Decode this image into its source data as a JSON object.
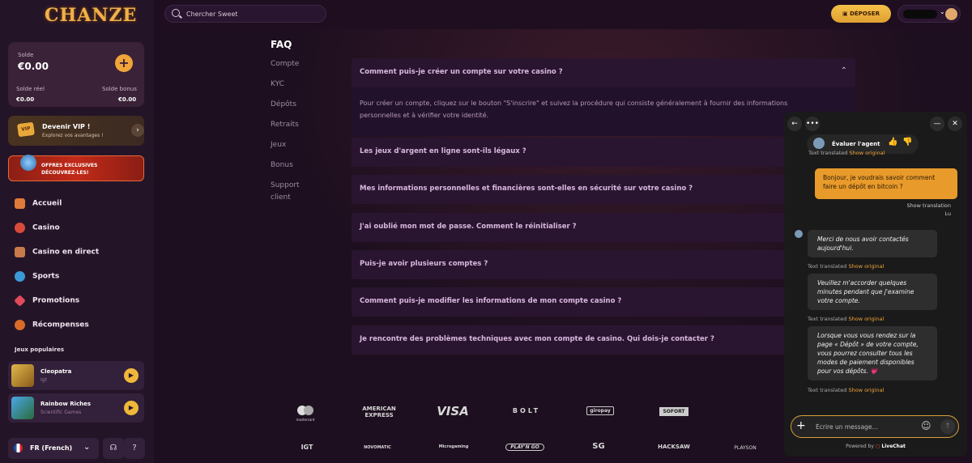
{
  "brand": {
    "logo_text": "CHANZE"
  },
  "topbar": {
    "search_placeholder": "Chercher Sweet",
    "deposit_label": "DÉPOSER"
  },
  "wallet": {
    "label": "Solde",
    "value": "€0.00",
    "real_label": "Solde réel",
    "real_value": "€0.00",
    "bonus_label": "Solde bonus",
    "bonus_value": "€0.00"
  },
  "vip": {
    "badge": "VIP",
    "title": "Devenir VIP !",
    "subtitle": "Explorez vos avantages !"
  },
  "offers": {
    "line1": "OFFRES EXCLUSIVES",
    "line2": "DÉCOUVREZ-LES!"
  },
  "nav": [
    {
      "label": "Accueil",
      "color": "#e07a3a",
      "icon": "home-icon"
    },
    {
      "label": "Casino",
      "color": "#d84a3a",
      "icon": "heart-casino-icon"
    },
    {
      "label": "Casino en direct",
      "color": "#c87a4a",
      "icon": "live-casino-icon"
    },
    {
      "label": "Sports",
      "color": "#3a9ad8",
      "icon": "ball-icon"
    },
    {
      "label": "Promotions",
      "color": "#e04a5a",
      "icon": "gem-icon"
    },
    {
      "label": "Récompenses",
      "color": "#d86a2a",
      "icon": "rewards-icon"
    }
  ],
  "popular": {
    "title": "Jeux populaires",
    "games": [
      {
        "name": "Cleopatra",
        "provider": "Igt",
        "color": "#c89a3a"
      },
      {
        "name": "Rainbow Riches",
        "provider": "Scientific Games",
        "color": "#3a8ad8"
      }
    ]
  },
  "language": {
    "label": "FR (French)"
  },
  "faq": {
    "title": "FAQ",
    "nav": [
      "Compte",
      "KYC",
      "Dépôts",
      "Retraits",
      "Jeux",
      "Bonus",
      "Support",
      "client"
    ],
    "items": [
      {
        "question": "Comment puis-je créer un compte sur votre casino ?",
        "expanded": true
      },
      {
        "question": "Les jeux d'argent en ligne sont-ils légaux ?"
      },
      {
        "question": "Mes informations personnelles et financières sont-elles en sécurité sur votre casino ?"
      },
      {
        "question": "J'ai oublié mon mot de passe. Comment le réinitialiser ?"
      },
      {
        "question": "Puis-je avoir plusieurs comptes ?"
      },
      {
        "question": "Comment puis-je modifier les informations de mon compte casino ?"
      },
      {
        "question": "Je rencontre des problèmes techniques avec mon compte de casino. Qui dois-je contacter ?"
      }
    ],
    "answer_line1": "Pour créer un compte, cliquez sur le bouton \"S'inscrire\" et suivez la procédure qui consiste généralement à fournir des informations",
    "answer_line2": "personnelles et à vérifier votre identité."
  },
  "payment_logos": [
    "mastercard",
    "AMERICAN EXPRESS",
    "VISA",
    "BOLT",
    "giropay",
    "SOFORT"
  ],
  "provider_logos": [
    "IGT",
    "NOVOMATIC",
    "Microgaming",
    "PLAY'N GO",
    "SG",
    "HACKSAW",
    "PLAYSON"
  ],
  "chat": {
    "rate_label": "Évaluer l'agent",
    "text_translated": "Text translated",
    "show_original": "Show original",
    "user_message": "Bonjour, je voudrais savoir comment faire un dépôt en bitcoin ?",
    "show_translation": "Show translation",
    "read_status": "Lu",
    "agent_messages": [
      "Merci de nous avoir contactés aujourd'hui.",
      "Veuillez m'accorder quelques minutes pendant que j'examine votre compte.",
      "Lorsque vous vous rendez sur la page « Dépôt » de votre compte, vous pourrez consulter tous les modes de paiement disponibles pour vos dépôts. 💗"
    ],
    "composer_placeholder": "Écrire un message...",
    "powered_by": "Powered by",
    "powered_brand": "LiveChat"
  }
}
